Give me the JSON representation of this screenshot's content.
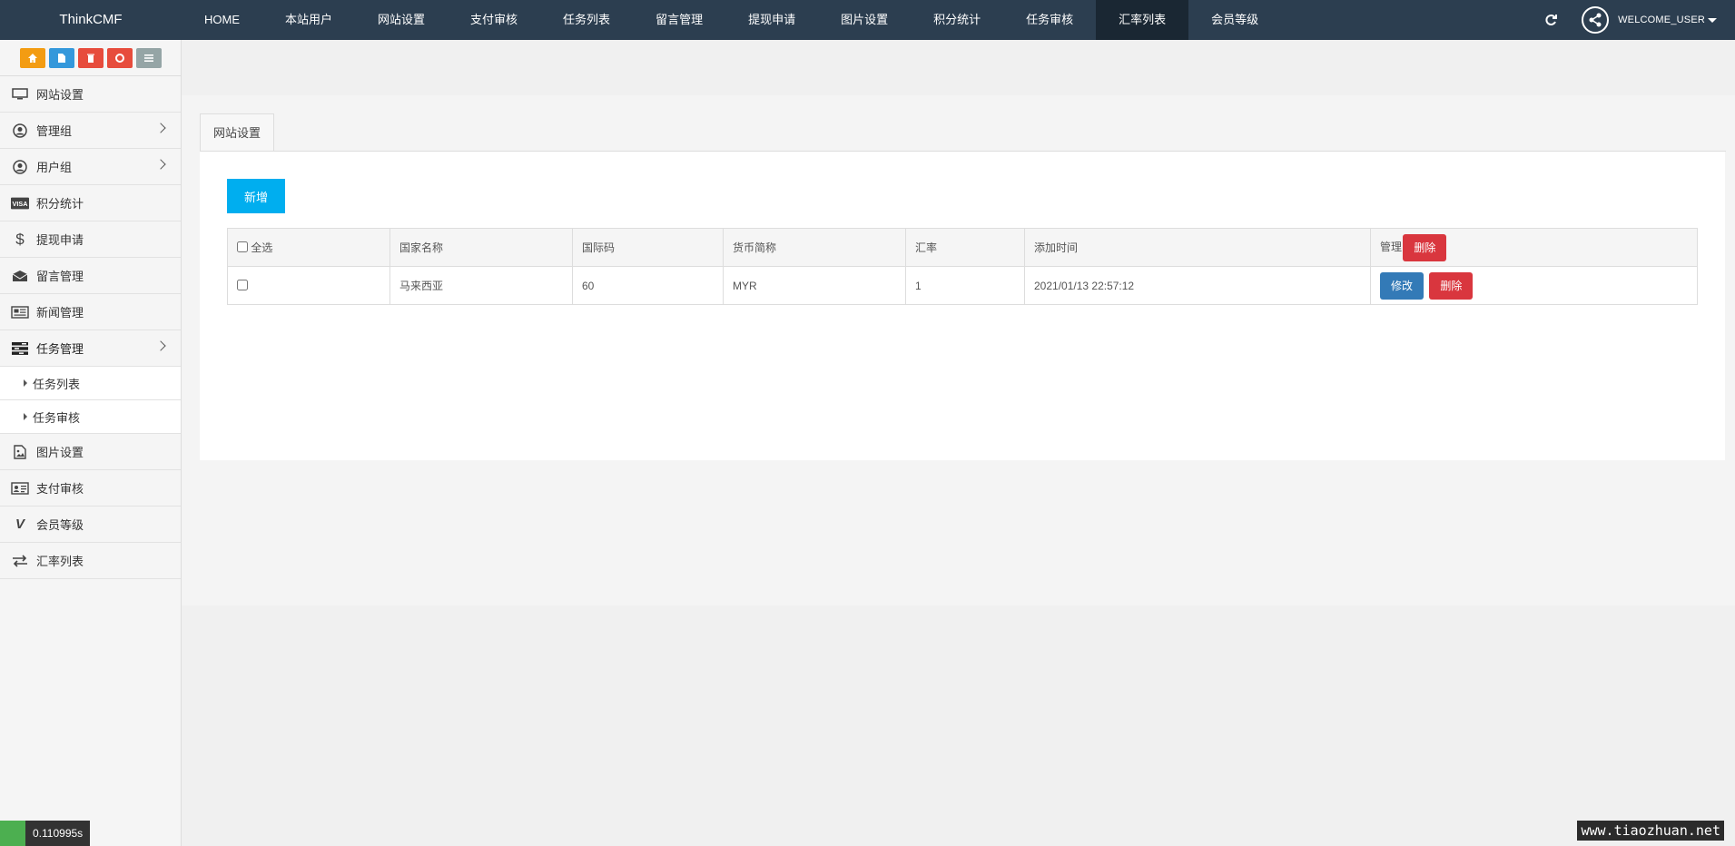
{
  "brand": "ThinkCMF",
  "nav": [
    "HOME",
    "本站用户",
    "网站设置",
    "支付审核",
    "任务列表",
    "留言管理",
    "提现申请",
    "图片设置",
    "积分统计",
    "任务审核",
    "汇率列表",
    "会员等级"
  ],
  "user": {
    "welcome": "WELCOME_USER"
  },
  "shortcut_colors": [
    "#f39c12",
    "#3498db",
    "#e74c3c",
    "#e74c3c",
    "#95a5a6"
  ],
  "sidebar": [
    {
      "label": "网站设置",
      "icon": "monitor-icon"
    },
    {
      "label": "管理组",
      "icon": "user-circle-icon"
    },
    {
      "label": "用户组",
      "icon": "user-circle-icon"
    },
    {
      "label": "积分统计",
      "icon": "visa-icon"
    },
    {
      "label": "提现申请",
      "icon": "dollar-icon"
    },
    {
      "label": "留言管理",
      "icon": "envelope-icon"
    },
    {
      "label": "新闻管理",
      "icon": "newspaper-icon"
    },
    {
      "label": "任务管理",
      "icon": "tasks-icon"
    },
    {
      "label": "图片设置",
      "icon": "image-icon"
    },
    {
      "label": "支付审核",
      "icon": "id-card-icon"
    },
    {
      "label": "会员等级",
      "icon": "vine-icon"
    },
    {
      "label": "汇率列表",
      "icon": "exchange-icon"
    }
  ],
  "submenu": [
    "任务列表",
    "任务审核"
  ],
  "tab": "网站设置",
  "add_button": "新增",
  "table": {
    "select_all": "全选",
    "headers": [
      "国家名称",
      "国际码",
      "货币简称",
      "汇率",
      "添加时间",
      "管理"
    ],
    "header_delete": "删除",
    "rows": [
      {
        "country": "马来西亚",
        "code": "60",
        "currency": "MYR",
        "rate": "1",
        "added": "2021/01/13 22:57:12",
        "edit": "修改",
        "delete": "删除"
      }
    ]
  },
  "debug_time": "0.110995s",
  "watermark": "www.tiaozhuan.net"
}
